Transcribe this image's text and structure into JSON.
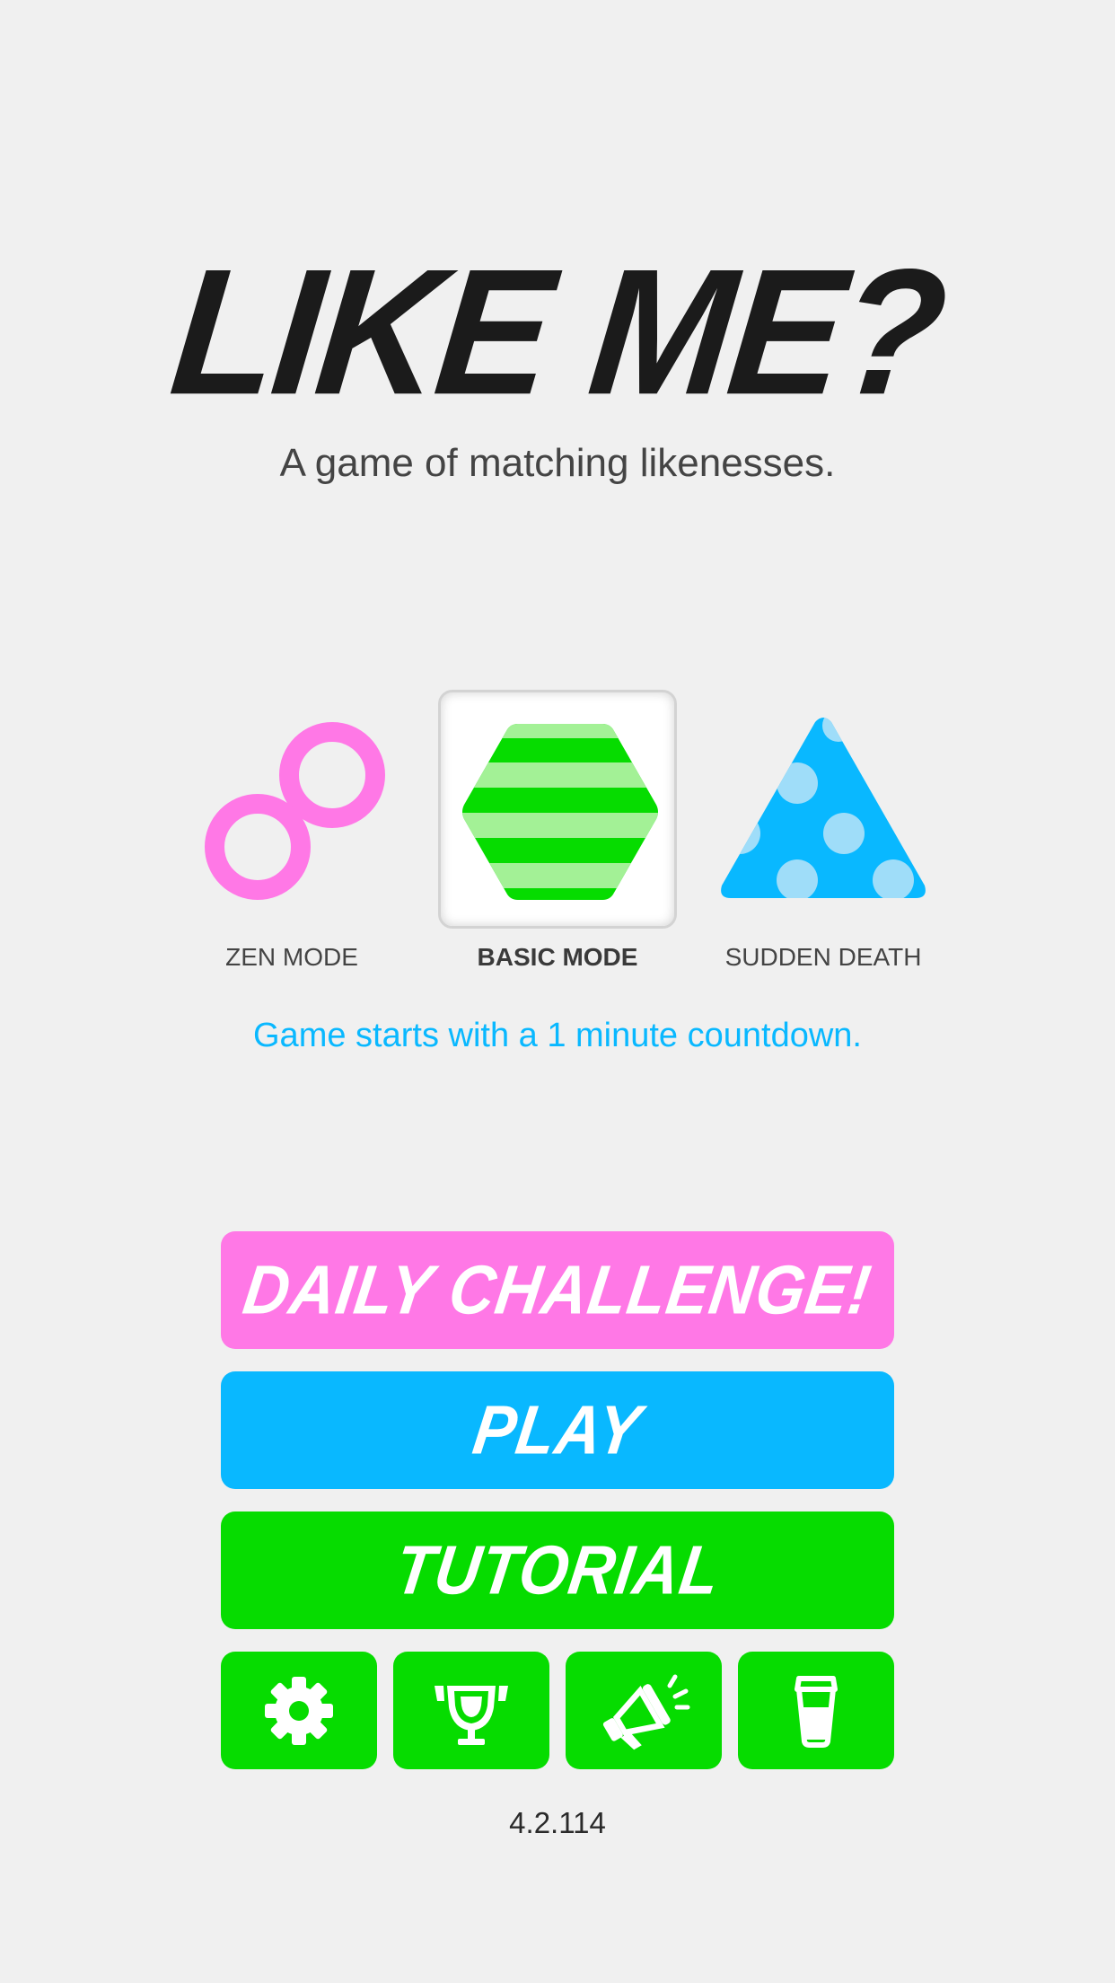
{
  "header": {
    "title": "LIKE ME?",
    "subtitle": "A game of matching likenesses."
  },
  "modes": [
    {
      "label": "ZEN MODE",
      "icon": "infinity-icon",
      "color": "#ff78e6",
      "selected": false
    },
    {
      "label": "BASIC MODE",
      "icon": "striped-hexagon-icon",
      "color": "#06dc00",
      "selected": true
    },
    {
      "label": "SUDDEN DEATH",
      "icon": "dotted-triangle-icon",
      "color": "#09b8ff",
      "selected": false
    }
  ],
  "mode_description": "Game starts with a 1 minute countdown.",
  "buttons": {
    "daily": "DAILY CHALLENGE!",
    "play": "PLAY",
    "tutorial": "TUTORIAL"
  },
  "toolbar": [
    {
      "icon": "gear-icon",
      "action": "settings"
    },
    {
      "icon": "trophy-icon",
      "action": "leaderboard"
    },
    {
      "icon": "megaphone-icon",
      "action": "share"
    },
    {
      "icon": "cup-icon",
      "action": "store"
    }
  ],
  "version": "4.2.114",
  "colors": {
    "background": "#f0f0f0",
    "pink": "#ff78e6",
    "blue": "#09b8ff",
    "green": "#06dc00",
    "title": "#1b1b1b",
    "text": "#444444"
  }
}
